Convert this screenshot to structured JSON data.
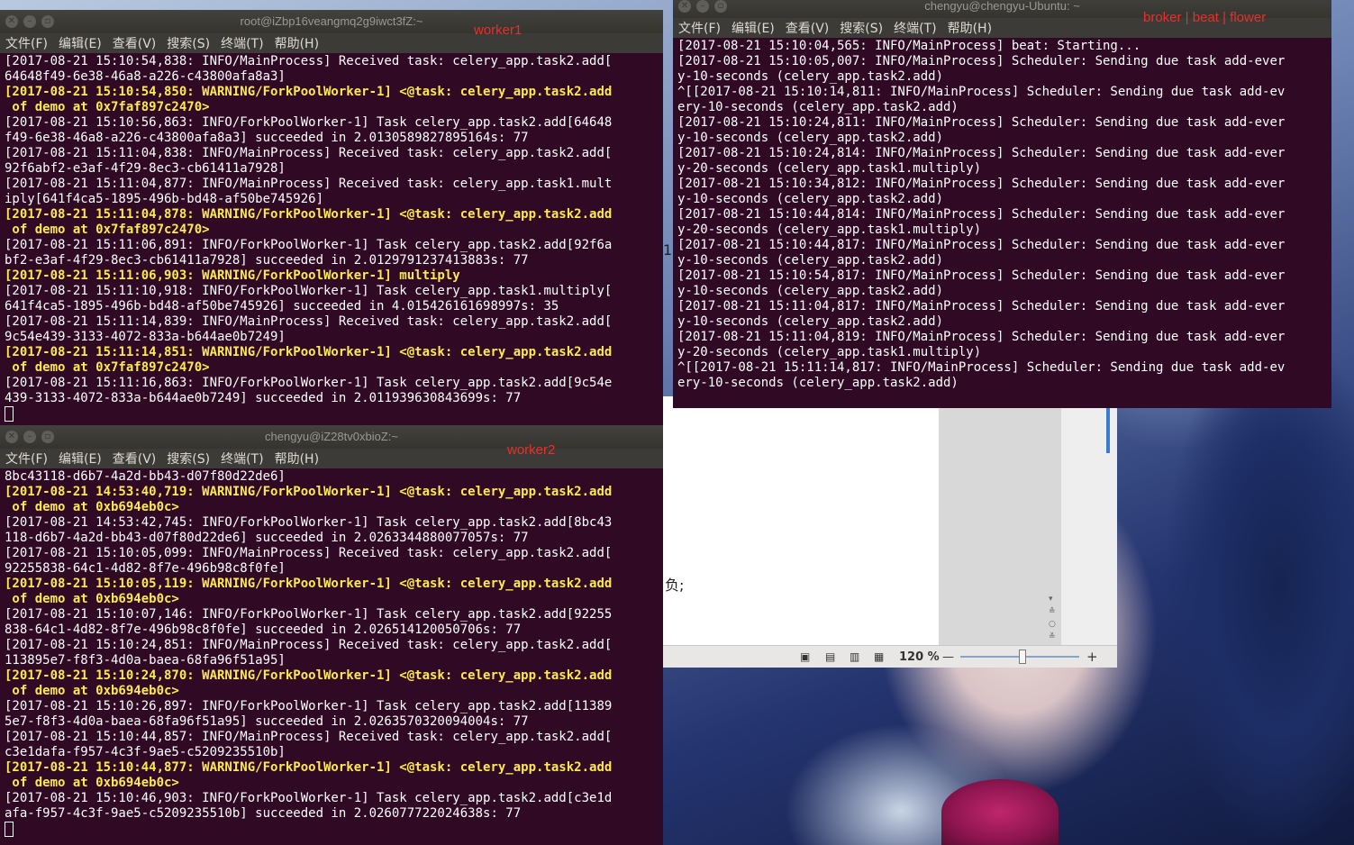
{
  "desktop": {
    "wallpaper": "anime illustration"
  },
  "menu_items": [
    "文件(F)",
    "编辑(E)",
    "查看(V)",
    "搜索(S)",
    "终端(T)",
    "帮助(H)"
  ],
  "doc_window": {
    "fragment_char_1": "1",
    "fragment_char_2": "负;",
    "zoom_label": "120 %",
    "zoom_minus": "—",
    "zoom_plus": "+",
    "scroll_arrows": "▾ ≙ ○ ≚"
  },
  "terminals": {
    "worker1": {
      "title": "root@iZbp16veangmq2g9iwct3fZ:~",
      "label": "worker1",
      "lines": [
        {
          "t": "[2017-08-21 15:10:54,838: INFO/MainProcess] Received task: celery_app.task2.add[",
          "w": false
        },
        {
          "t": "64648f49-6e38-46a8-a226-c43800afa8a3]",
          "w": false
        },
        {
          "t": "[2017-08-21 15:10:54,850: WARNING/ForkPoolWorker-1] <@task: celery_app.task2.add",
          "w": true
        },
        {
          "t": " of demo at 0x7faf897c2470>",
          "w": true
        },
        {
          "t": "[2017-08-21 15:10:56,863: INFO/ForkPoolWorker-1] Task celery_app.task2.add[64648",
          "w": false
        },
        {
          "t": "f49-6e38-46a8-a226-c43800afa8a3] succeeded in 2.0130589827895164s: 77",
          "w": false
        },
        {
          "t": "[2017-08-21 15:11:04,838: INFO/MainProcess] Received task: celery_app.task2.add[",
          "w": false
        },
        {
          "t": "92f6abf2-e3af-4f29-8ec3-cb61411a7928]",
          "w": false
        },
        {
          "t": "[2017-08-21 15:11:04,877: INFO/MainProcess] Received task: celery_app.task1.mult",
          "w": false
        },
        {
          "t": "iply[641f4ca5-1895-496b-bd48-af50be745926]",
          "w": false
        },
        {
          "t": "[2017-08-21 15:11:04,878: WARNING/ForkPoolWorker-1] <@task: celery_app.task2.add",
          "w": true
        },
        {
          "t": " of demo at 0x7faf897c2470>",
          "w": true
        },
        {
          "t": "[2017-08-21 15:11:06,891: INFO/ForkPoolWorker-1] Task celery_app.task2.add[92f6a",
          "w": false
        },
        {
          "t": "bf2-e3af-4f29-8ec3-cb61411a7928] succeeded in 2.0129791237413883s: 77",
          "w": false
        },
        {
          "t": "[2017-08-21 15:11:06,903: WARNING/ForkPoolWorker-1] multiply",
          "w": true
        },
        {
          "t": "[2017-08-21 15:11:10,918: INFO/ForkPoolWorker-1] Task celery_app.task1.multiply[",
          "w": false
        },
        {
          "t": "641f4ca5-1895-496b-bd48-af50be745926] succeeded in 4.015426161698997s: 35",
          "w": false
        },
        {
          "t": "[2017-08-21 15:11:14,839: INFO/MainProcess] Received task: celery_app.task2.add[",
          "w": false
        },
        {
          "t": "9c54e439-3133-4072-833a-b644ae0b7249]",
          "w": false
        },
        {
          "t": "[2017-08-21 15:11:14,851: WARNING/ForkPoolWorker-1] <@task: celery_app.task2.add",
          "w": true
        },
        {
          "t": " of demo at 0x7faf897c2470>",
          "w": true
        },
        {
          "t": "[2017-08-21 15:11:16,863: INFO/ForkPoolWorker-1] Task celery_app.task2.add[9c54e",
          "w": false
        },
        {
          "t": "439-3133-4072-833a-b644ae0b7249] succeeded in 2.011939630843699s: 77",
          "w": false
        }
      ]
    },
    "worker2": {
      "title": "chengyu@iZ28tv0xbioZ:~",
      "label": "worker2",
      "lines": [
        {
          "t": "8bc43118-d6b7-4a2d-bb43-d07f80d22de6]",
          "w": false
        },
        {
          "t": "[2017-08-21 14:53:40,719: WARNING/ForkPoolWorker-1] <@task: celery_app.task2.add",
          "w": true
        },
        {
          "t": " of demo at 0xb694eb0c>",
          "w": true
        },
        {
          "t": "[2017-08-21 14:53:42,745: INFO/ForkPoolWorker-1] Task celery_app.task2.add[8bc43",
          "w": false
        },
        {
          "t": "118-d6b7-4a2d-bb43-d07f80d22de6] succeeded in 2.0263344880077057s: 77",
          "w": false
        },
        {
          "t": "[2017-08-21 15:10:05,099: INFO/MainProcess] Received task: celery_app.task2.add[",
          "w": false
        },
        {
          "t": "92255838-64c1-4d82-8f7e-496b98c8f0fe]",
          "w": false
        },
        {
          "t": "[2017-08-21 15:10:05,119: WARNING/ForkPoolWorker-1] <@task: celery_app.task2.add",
          "w": true
        },
        {
          "t": " of demo at 0xb694eb0c>",
          "w": true
        },
        {
          "t": "[2017-08-21 15:10:07,146: INFO/ForkPoolWorker-1] Task celery_app.task2.add[92255",
          "w": false
        },
        {
          "t": "838-64c1-4d82-8f7e-496b98c8f0fe] succeeded in 2.026514120050706s: 77",
          "w": false
        },
        {
          "t": "[2017-08-21 15:10:24,851: INFO/MainProcess] Received task: celery_app.task2.add[",
          "w": false
        },
        {
          "t": "113895e7-f8f3-4d0a-baea-68fa96f51a95]",
          "w": false
        },
        {
          "t": "[2017-08-21 15:10:24,870: WARNING/ForkPoolWorker-1] <@task: celery_app.task2.add",
          "w": true
        },
        {
          "t": " of demo at 0xb694eb0c>",
          "w": true
        },
        {
          "t": "[2017-08-21 15:10:26,897: INFO/ForkPoolWorker-1] Task celery_app.task2.add[11389",
          "w": false
        },
        {
          "t": "5e7-f8f3-4d0a-baea-68fa96f51a95] succeeded in 2.0263570320094004s: 77",
          "w": false
        },
        {
          "t": "[2017-08-21 15:10:44,857: INFO/MainProcess] Received task: celery_app.task2.add[",
          "w": false
        },
        {
          "t": "c3e1dafa-f957-4c3f-9ae5-c5209235510b]",
          "w": false
        },
        {
          "t": "[2017-08-21 15:10:44,877: WARNING/ForkPoolWorker-1] <@task: celery_app.task2.add",
          "w": true
        },
        {
          "t": " of demo at 0xb694eb0c>",
          "w": true
        },
        {
          "t": "[2017-08-21 15:10:46,903: INFO/ForkPoolWorker-1] Task celery_app.task2.add[c3e1d",
          "w": false
        },
        {
          "t": "afa-f957-4c3f-9ae5-c5209235510b] succeeded in 2.026077722024638s: 77",
          "w": false
        }
      ]
    },
    "beat": {
      "title": "chengyu@chengyu-Ubuntu: ~",
      "label": "broker | beat | flower",
      "lines": [
        {
          "t": "[2017-08-21 15:10:04,565: INFO/MainProcess] beat: Starting...",
          "w": false
        },
        {
          "t": "[2017-08-21 15:10:05,007: INFO/MainProcess] Scheduler: Sending due task add-ever",
          "w": false
        },
        {
          "t": "y-10-seconds (celery_app.task2.add)",
          "w": false
        },
        {
          "t": "^[[2017-08-21 15:10:14,811: INFO/MainProcess] Scheduler: Sending due task add-ev",
          "w": false
        },
        {
          "t": "ery-10-seconds (celery_app.task2.add)",
          "w": false
        },
        {
          "t": "[2017-08-21 15:10:24,811: INFO/MainProcess] Scheduler: Sending due task add-ever",
          "w": false
        },
        {
          "t": "y-10-seconds (celery_app.task2.add)",
          "w": false
        },
        {
          "t": "[2017-08-21 15:10:24,814: INFO/MainProcess] Scheduler: Sending due task add-ever",
          "w": false
        },
        {
          "t": "y-20-seconds (celery_app.task1.multiply)",
          "w": false
        },
        {
          "t": "[2017-08-21 15:10:34,812: INFO/MainProcess] Scheduler: Sending due task add-ever",
          "w": false
        },
        {
          "t": "y-10-seconds (celery_app.task2.add)",
          "w": false
        },
        {
          "t": "[2017-08-21 15:10:44,814: INFO/MainProcess] Scheduler: Sending due task add-ever",
          "w": false
        },
        {
          "t": "y-20-seconds (celery_app.task1.multiply)",
          "w": false
        },
        {
          "t": "[2017-08-21 15:10:44,817: INFO/MainProcess] Scheduler: Sending due task add-ever",
          "w": false
        },
        {
          "t": "y-10-seconds (celery_app.task2.add)",
          "w": false
        },
        {
          "t": "[2017-08-21 15:10:54,817: INFO/MainProcess] Scheduler: Sending due task add-ever",
          "w": false
        },
        {
          "t": "y-10-seconds (celery_app.task2.add)",
          "w": false
        },
        {
          "t": "[2017-08-21 15:11:04,817: INFO/MainProcess] Scheduler: Sending due task add-ever",
          "w": false
        },
        {
          "t": "y-10-seconds (celery_app.task2.add)",
          "w": false
        },
        {
          "t": "[2017-08-21 15:11:04,819: INFO/MainProcess] Scheduler: Sending due task add-ever",
          "w": false
        },
        {
          "t": "y-20-seconds (celery_app.task1.multiply)",
          "w": false
        },
        {
          "t": "^[[2017-08-21 15:11:14,817: INFO/MainProcess] Scheduler: Sending due task add-ev",
          "w": false
        },
        {
          "t": "ery-10-seconds (celery_app.task2.add)",
          "w": false
        }
      ]
    }
  },
  "colors": {
    "terminal_bg": "#300a24",
    "warning_text": "#fce94f",
    "label_red": "#e8302a"
  }
}
